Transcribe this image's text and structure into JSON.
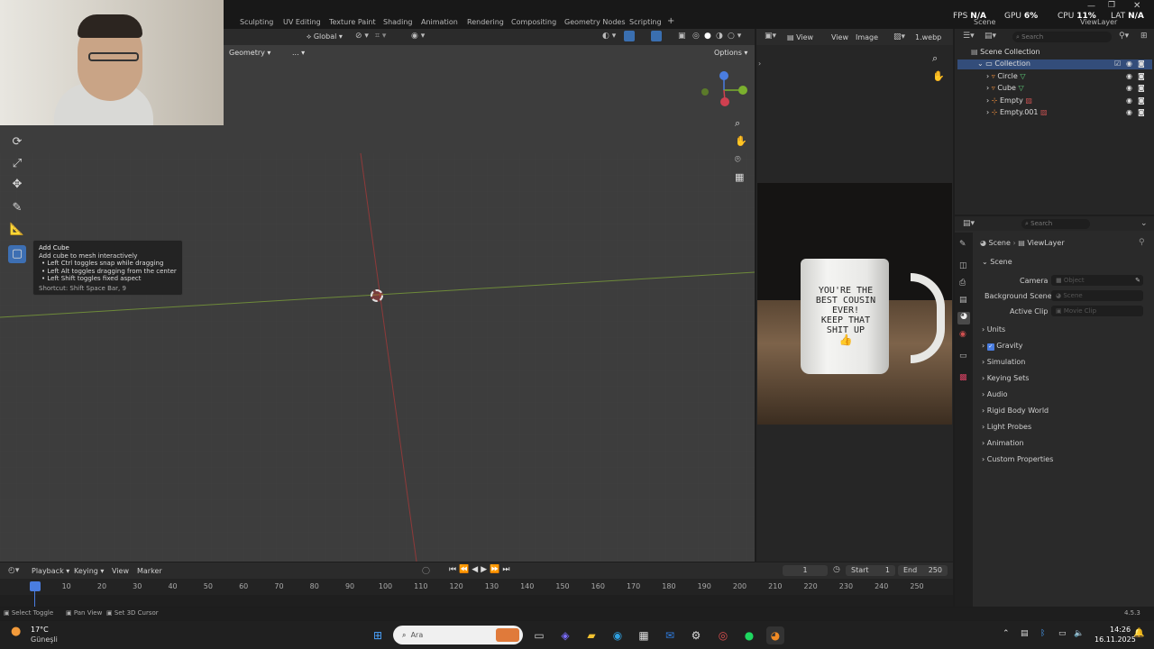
{
  "topbar": {
    "workspaces": [
      "Sculpting",
      "UV Editing",
      "Texture Paint",
      "Shading",
      "Animation",
      "Rendering",
      "Compositing",
      "Geometry Nodes",
      "Scripting"
    ],
    "add_tab": "+",
    "scene": "Scene",
    "viewlayer": "ViewLayer",
    "stats": {
      "fps_label": "FPS",
      "fps": "N/A",
      "gpu_label": "GPU",
      "gpu": "6%",
      "cpu_label": "CPU",
      "cpu": "11%",
      "lat_label": "LAT",
      "lat": "N/A"
    }
  },
  "viewport_header": {
    "orientation": "Global",
    "mode_dropdown": "Geometry",
    "more": "...",
    "options": "Options"
  },
  "tooltip": {
    "title": "Add Cube",
    "desc": "Add cube to mesh interactively",
    "lines": [
      "• Left Ctrl toggles snap while dragging",
      "• Left Alt toggles dragging from the center",
      "• Left Shift toggles fixed aspect"
    ],
    "shortcut": "Shortcut: Shift Space Bar, 9"
  },
  "image_editor": {
    "menus": [
      "View",
      "View",
      "Image"
    ],
    "image_name": "1.webp",
    "mug_text": [
      "YOU'RE THE",
      "BEST COUSIN",
      "EVER!",
      "KEEP THAT",
      "SHIT UP"
    ]
  },
  "outliner": {
    "search_placeholder": "Search",
    "root": "Scene Collection",
    "collection": "Collection",
    "items": [
      "Circle",
      "Cube",
      "Empty",
      "Empty.001"
    ]
  },
  "properties": {
    "search_placeholder": "Search",
    "breadcrumb": [
      "Scene",
      "ViewLayer"
    ],
    "section": "Scene",
    "fields": [
      {
        "label": "Camera",
        "placeholder": "Object"
      },
      {
        "label": "Background Scene",
        "placeholder": "Scene"
      },
      {
        "label": "Active Clip",
        "placeholder": "Movie Clip"
      }
    ],
    "panels": [
      "Units",
      "Gravity",
      "Simulation",
      "Keying Sets",
      "Audio",
      "Rigid Body World",
      "Light Probes",
      "Animation",
      "Custom Properties"
    ],
    "gravity_checked": true
  },
  "timeline": {
    "menus": [
      "Playback",
      "Keying",
      "View",
      "Marker"
    ],
    "current_frame": "1",
    "start_label": "Start",
    "start": "1",
    "end_label": "End",
    "end": "250",
    "ticks": [
      "1",
      "10",
      "20",
      "30",
      "40",
      "50",
      "60",
      "70",
      "80",
      "90",
      "100",
      "110",
      "120",
      "130",
      "140",
      "150",
      "160",
      "170",
      "180",
      "190",
      "200",
      "210",
      "220",
      "230",
      "240",
      "250"
    ]
  },
  "statusbar": {
    "items": [
      "Select Toggle",
      "Pan View",
      "Set 3D Cursor"
    ],
    "version": "4.5.3"
  },
  "taskbar": {
    "weather_temp": "17°C",
    "weather_desc": "Güneşli",
    "search_placeholder": "Ara",
    "time": "14:26",
    "date": "16.11.2025"
  }
}
